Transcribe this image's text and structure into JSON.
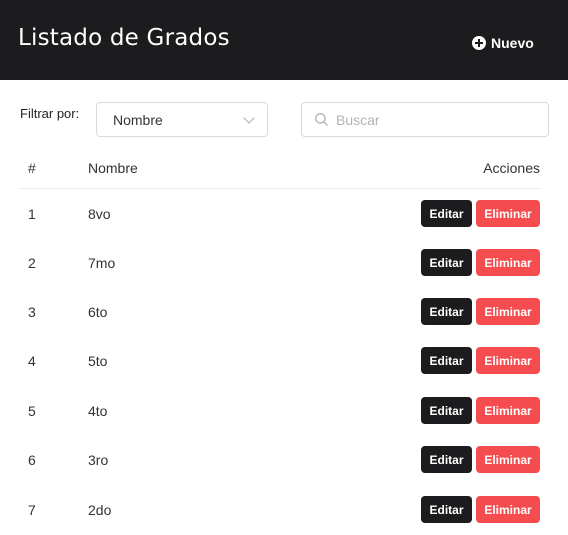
{
  "header": {
    "title": "Listado de Grados",
    "new_button_label": "Nuevo",
    "new_button_icon": "plus-circle-icon",
    "background_color": "#1c1c1e"
  },
  "filter": {
    "label": "Filtrar por:",
    "selected": "Nombre"
  },
  "search": {
    "placeholder": "Buscar",
    "value": ""
  },
  "table": {
    "columns": {
      "number": "#",
      "name": "Nombre",
      "actions": "Acciones"
    },
    "edit_label": "Editar",
    "delete_label": "Eliminar",
    "rows": [
      {
        "number": "1",
        "name": "8vo"
      },
      {
        "number": "2",
        "name": "7mo"
      },
      {
        "number": "3",
        "name": "6to"
      },
      {
        "number": "4",
        "name": "5to"
      },
      {
        "number": "5",
        "name": "4to"
      },
      {
        "number": "6",
        "name": "3ro"
      },
      {
        "number": "7",
        "name": "2do"
      }
    ]
  },
  "colors": {
    "edit_button": "#1c1c1e",
    "delete_button": "#f54d4f"
  }
}
